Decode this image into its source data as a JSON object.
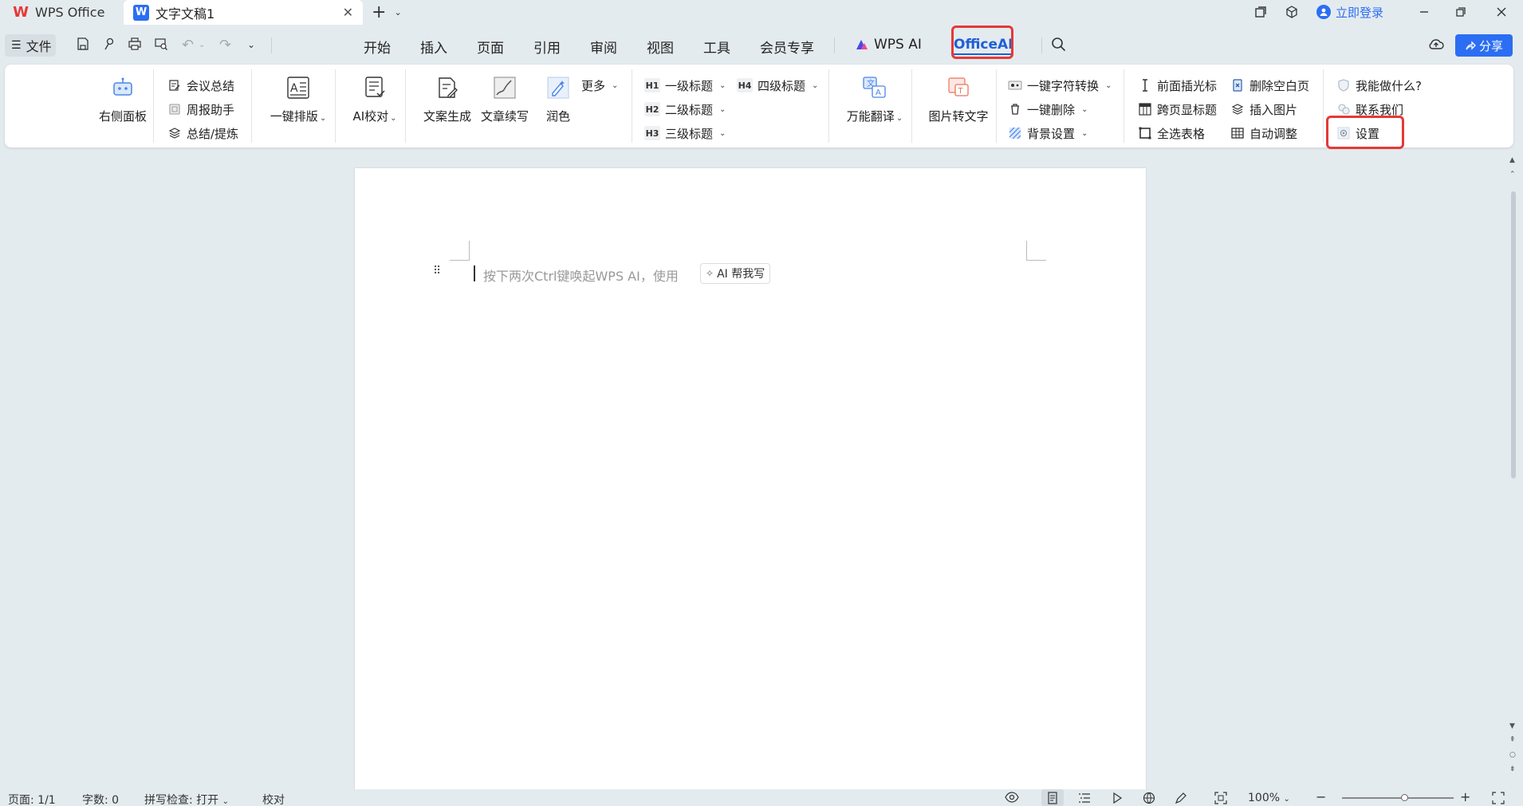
{
  "titlebar": {
    "tabs": [
      {
        "label": "WPS Office"
      },
      {
        "label": "文字文稿1"
      }
    ],
    "login": "立即登录"
  },
  "toolbar": {
    "file_label": "文件",
    "menus": [
      "开始",
      "插入",
      "页面",
      "引用",
      "审阅",
      "视图",
      "工具",
      "会员专享",
      "WPS AI",
      "OfficeAI"
    ],
    "share_label": "分享"
  },
  "ribbon": {
    "right_panel": "右侧面板",
    "meeting_summary": "会议总结",
    "weekly_helper": "周报助手",
    "summary_refine": "总结/提炼",
    "one_key_layout": "一键排版",
    "ai_proofread": "AI校对",
    "copy_gen": "文案生成",
    "article_continue": "文章续写",
    "polish": "润色",
    "more": "更多",
    "h1": "一级标题",
    "h2": "二级标题",
    "h3": "三级标题",
    "h4": "四级标题",
    "h1_badge": "H1",
    "h2_badge": "H2",
    "h3_badge": "H3",
    "h4_badge": "H4",
    "translate": "万能翻译",
    "img_to_text": "图片转文字",
    "char_convert": "一键字符转换",
    "one_key_delete": "一键删除",
    "bg_settings": "背景设置",
    "insert_cursor": "前面插光标",
    "cross_page_title": "跨页显标题",
    "select_all_tables": "全选表格",
    "delete_blank_page": "删除空白页",
    "insert_image": "插入图片",
    "auto_adjust": "自动调整",
    "what_can_i_do": "我能做什么?",
    "contact_us": "联系我们",
    "settings": "设置"
  },
  "document": {
    "placeholder": "按下两次Ctrl键唤起WPS AI，使用",
    "ai_button": "AI 帮我写"
  },
  "status": {
    "page": "页面: 1/1",
    "word_count": "字数: 0",
    "spell_check": "拼写检查: 打开",
    "proofread": "校对",
    "zoom": "100%",
    "zoom_level": 0.56
  },
  "colors": {
    "accent": "#2b6ef3",
    "highlight": "#e53935"
  }
}
